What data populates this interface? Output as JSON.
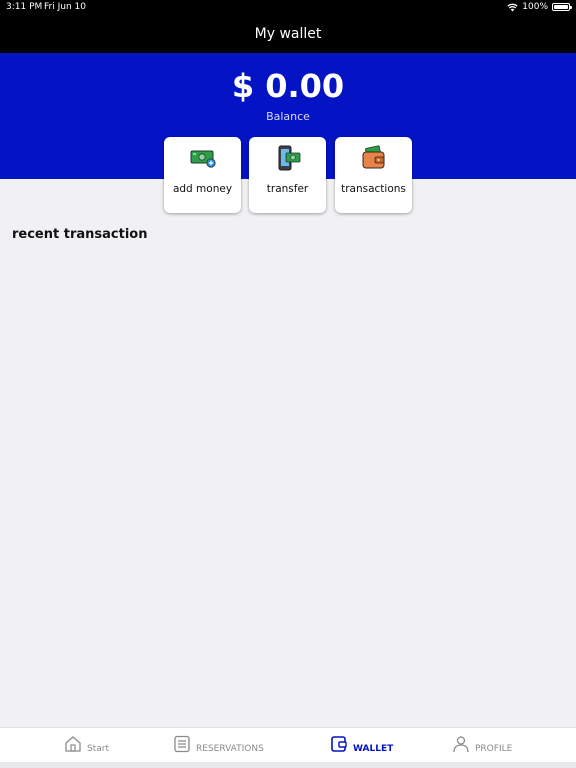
{
  "status": {
    "time": "3:11 PM",
    "date": "Fri Jun 10",
    "battery": "100%"
  },
  "header": {
    "title": "My wallet"
  },
  "wallet": {
    "balance": "$ 0.00",
    "balance_label": "Balance"
  },
  "actions": [
    {
      "label": "add money",
      "icon": "add-money-icon"
    },
    {
      "label": "transfer",
      "icon": "phone-transfer-icon"
    },
    {
      "label": "transactions",
      "icon": "wallet-icon"
    }
  ],
  "recent": {
    "title": "recent transaction"
  },
  "tabs": [
    {
      "label": "Start",
      "icon": "home-icon"
    },
    {
      "label": "RESERVATIONS",
      "icon": "list-icon"
    },
    {
      "label": "WALLET",
      "icon": "wallet-icon",
      "active": true
    },
    {
      "label": "PROFILE",
      "icon": "person-icon"
    }
  ],
  "colors": {
    "brand_blue": "#0414c4",
    "header_black": "#000000",
    "money_green": "#2e9e4a"
  }
}
